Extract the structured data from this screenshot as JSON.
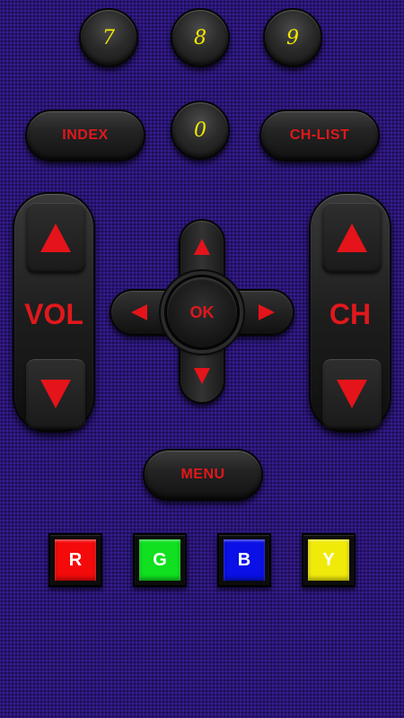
{
  "number_keys": {
    "k7": "7",
    "k8": "8",
    "k9": "9",
    "k0": "0"
  },
  "buttons": {
    "index": "INDEX",
    "ch_list": "CH-LIST",
    "menu": "MENU",
    "ok": "OK"
  },
  "rockers": {
    "volume_label": "VOL",
    "channel_label": "CH"
  },
  "color_keys": [
    {
      "label": "R",
      "color": "#f40a0a",
      "text_color": "#ffffff"
    },
    {
      "label": "G",
      "color": "#10e020",
      "text_color": "#ffffff"
    },
    {
      "label": "B",
      "color": "#0a10e6",
      "text_color": "#ffffff"
    },
    {
      "label": "Y",
      "color": "#f0ea0a",
      "text_color": "#ffffff"
    }
  ],
  "theme": {
    "background": "#2a1577",
    "accent_red": "#e0181c",
    "digit_yellow": "#f2e600"
  }
}
